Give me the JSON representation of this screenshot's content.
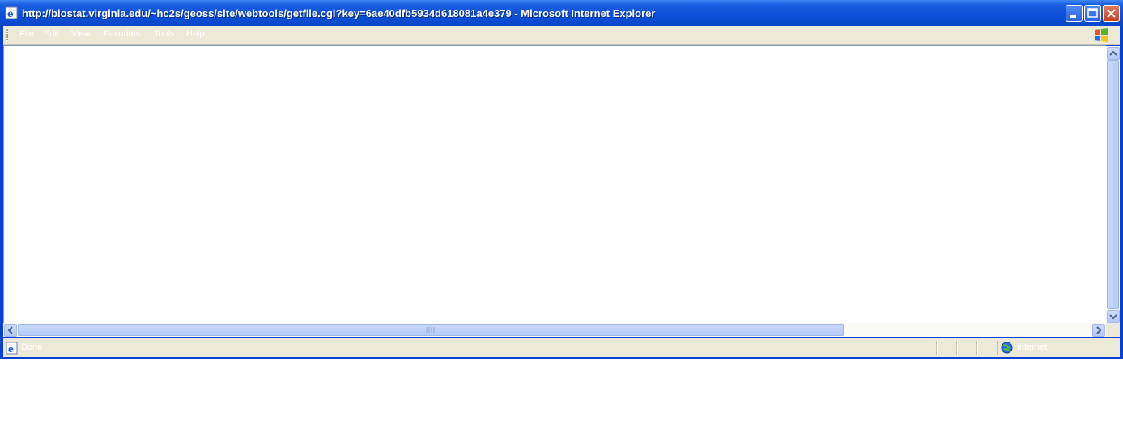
{
  "window": {
    "title": "http://biostat.virginia.edu/~hc2s/geoss/site/webtools/getfile.cgi?key=6ae40dfb5934d618081a4e379 - Microsoft Internet Explorer"
  },
  "menubar": {
    "items": [
      {
        "label": "File"
      },
      {
        "label": "Edit"
      },
      {
        "label": "View"
      },
      {
        "label": "Favorites"
      },
      {
        "label": "Tools"
      },
      {
        "label": "Help"
      }
    ]
  },
  "statusbar": {
    "status": "Done",
    "zone": "Internet"
  },
  "colors": {
    "titlebar": "#0c4fd8",
    "chrome": "#ece9d8",
    "scrollbar": "#b6cbf7"
  }
}
